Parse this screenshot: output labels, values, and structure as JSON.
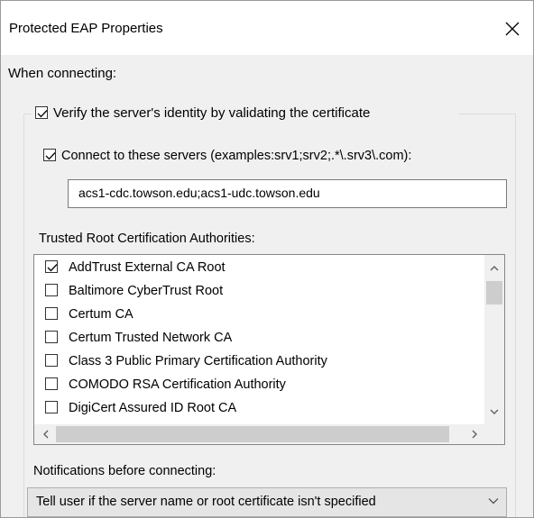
{
  "window": {
    "title": "Protected EAP Properties"
  },
  "when_connecting": {
    "label": "When connecting:",
    "verify_checkbox": {
      "label": "Verify the server's identity by validating the certificate",
      "checked": true
    },
    "connect_checkbox": {
      "label": "Connect to these servers (examples:srv1;srv2;.*\\.srv3\\.com):",
      "checked": true
    },
    "servers_value": "acs1-cdc.towson.edu;acs1-udc.towson.edu",
    "trusted_label": "Trusted Root Certification Authorities:",
    "authorities": [
      {
        "label": "AddTrust External CA Root",
        "checked": true
      },
      {
        "label": "Baltimore CyberTrust Root",
        "checked": false
      },
      {
        "label": "Certum CA",
        "checked": false
      },
      {
        "label": "Certum Trusted Network CA",
        "checked": false
      },
      {
        "label": "Class 3 Public Primary Certification Authority",
        "checked": false
      },
      {
        "label": "COMODO RSA Certification Authority",
        "checked": false
      },
      {
        "label": "DigiCert Assured ID Root CA",
        "checked": false
      }
    ],
    "notifications_label": "Notifications before connecting:",
    "notifications_value": "Tell user if the server name or root certificate isn't specified"
  },
  "icons": {
    "close": "close-icon",
    "checkmark": "checkmark-icon",
    "scroll_up": "chevron-up-icon",
    "scroll_down": "chevron-down-icon",
    "scroll_left": "chevron-left-icon",
    "scroll_right": "chevron-right-icon",
    "dropdown": "chevron-down-icon"
  }
}
